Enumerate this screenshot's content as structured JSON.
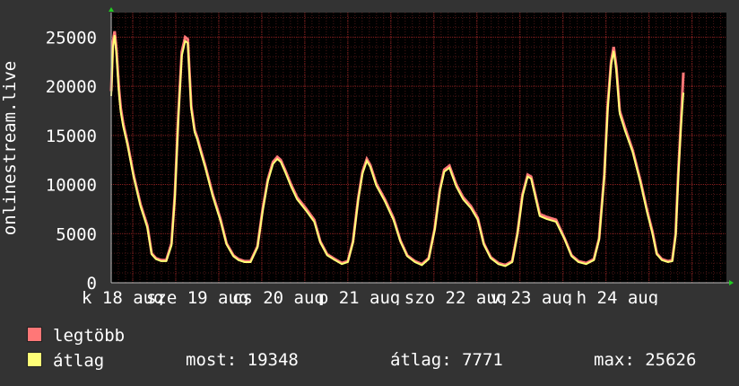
{
  "chart_data": {
    "type": "line",
    "ylabel": "onlinestream.live",
    "ylim": [
      0,
      27500
    ],
    "yticks": [
      0,
      5000,
      10000,
      15000,
      20000,
      25000
    ],
    "xlim": [
      0,
      7.15
    ],
    "xticks": [
      {
        "x": 0.0,
        "label": "k 18 aug"
      },
      {
        "x": 0.75,
        "label": "sze 19 aug"
      },
      {
        "x": 1.75,
        "label": "cs 20 aug"
      },
      {
        "x": 2.75,
        "label": "p 21 aug"
      },
      {
        "x": 3.75,
        "label": "szo 22 aug"
      },
      {
        "x": 4.75,
        "label": "v 23 aug"
      },
      {
        "x": 5.75,
        "label": "h 24 aug"
      }
    ],
    "grid": true,
    "colors": {
      "max": "#ff7777",
      "avg": "#ffff77",
      "grid": "#8a2020",
      "axis": "#bbbbbb"
    },
    "series": [
      {
        "name": "legtöbb",
        "x": [
          0.0,
          0.02,
          0.04,
          0.06,
          0.09,
          0.11,
          0.14,
          0.19,
          0.26,
          0.34,
          0.42,
          0.47,
          0.52,
          0.58,
          0.64,
          0.7,
          0.74,
          0.78,
          0.82,
          0.86,
          0.89,
          0.93,
          0.97,
          1.0,
          1.04,
          1.09,
          1.18,
          1.27,
          1.34,
          1.42,
          1.48,
          1.55,
          1.62,
          1.7,
          1.76,
          1.82,
          1.88,
          1.93,
          1.97,
          2.02,
          2.09,
          2.16,
          2.26,
          2.36,
          2.43,
          2.51,
          2.6,
          2.68,
          2.75,
          2.81,
          2.87,
          2.92,
          2.97,
          3.01,
          3.08,
          3.18,
          3.28,
          3.36,
          3.44,
          3.53,
          3.61,
          3.69,
          3.76,
          3.82,
          3.87,
          3.93,
          3.96,
          4.01,
          4.09,
          4.18,
          4.26,
          4.33,
          4.41,
          4.5,
          4.58,
          4.66,
          4.72,
          4.78,
          4.84,
          4.88,
          4.92,
          4.98,
          5.06,
          5.17,
          5.27,
          5.35,
          5.43,
          5.52,
          5.61,
          5.67,
          5.73,
          5.77,
          5.81,
          5.84,
          5.87,
          5.91,
          5.97,
          6.06,
          6.15,
          6.23,
          6.29,
          6.34,
          6.4,
          6.47,
          6.52,
          6.56,
          6.59,
          6.62,
          6.65
        ],
        "values": [
          19500,
          24500,
          25600,
          23800,
          19800,
          17800,
          16200,
          14200,
          11000,
          8000,
          5800,
          3000,
          2500,
          2300,
          2300,
          4000,
          9000,
          17000,
          23500,
          25000,
          24800,
          18000,
          15500,
          14800,
          13500,
          12000,
          9000,
          6500,
          4000,
          2800,
          2400,
          2200,
          2200,
          3700,
          7500,
          10500,
          12300,
          12800,
          12500,
          11500,
          10000,
          8700,
          7600,
          6400,
          4200,
          2900,
          2400,
          2000,
          2200,
          4200,
          8600,
          11300,
          12600,
          12000,
          10100,
          8500,
          6600,
          4300,
          2800,
          2200,
          1900,
          2500,
          5500,
          9500,
          11500,
          11900,
          11200,
          10000,
          8700,
          7800,
          6600,
          4000,
          2600,
          2000,
          1800,
          2200,
          5000,
          9000,
          11000,
          10800,
          9300,
          7000,
          6700,
          6400,
          4500,
          2800,
          2200,
          2000,
          2400,
          4500,
          11000,
          18000,
          22500,
          24000,
          22000,
          17500,
          15800,
          13500,
          10400,
          7300,
          5200,
          3000,
          2400,
          2200,
          2300,
          5000,
          11200,
          16000,
          21400
        ]
      },
      {
        "name": "átlag",
        "x": [
          0.0,
          0.02,
          0.04,
          0.06,
          0.09,
          0.11,
          0.14,
          0.19,
          0.26,
          0.34,
          0.42,
          0.47,
          0.52,
          0.58,
          0.64,
          0.7,
          0.74,
          0.78,
          0.82,
          0.86,
          0.89,
          0.93,
          0.97,
          1.0,
          1.04,
          1.09,
          1.18,
          1.27,
          1.34,
          1.42,
          1.48,
          1.55,
          1.62,
          1.7,
          1.76,
          1.82,
          1.88,
          1.93,
          1.97,
          2.02,
          2.09,
          2.16,
          2.26,
          2.36,
          2.43,
          2.51,
          2.6,
          2.68,
          2.75,
          2.81,
          2.87,
          2.92,
          2.97,
          3.01,
          3.08,
          3.18,
          3.28,
          3.36,
          3.44,
          3.53,
          3.61,
          3.69,
          3.76,
          3.82,
          3.87,
          3.93,
          3.96,
          4.01,
          4.09,
          4.18,
          4.26,
          4.33,
          4.41,
          4.5,
          4.58,
          4.66,
          4.72,
          4.78,
          4.84,
          4.88,
          4.92,
          4.98,
          5.06,
          5.17,
          5.27,
          5.35,
          5.43,
          5.52,
          5.61,
          5.67,
          5.73,
          5.77,
          5.81,
          5.84,
          5.87,
          5.91,
          5.97,
          6.06,
          6.15,
          6.23,
          6.29,
          6.34,
          6.4,
          6.47,
          6.52,
          6.56,
          6.59,
          6.62,
          6.65
        ],
        "values": [
          19000,
          24000,
          25200,
          23300,
          19300,
          17400,
          15900,
          14000,
          10800,
          7800,
          5600,
          2900,
          2400,
          2200,
          2200,
          3800,
          8700,
          16600,
          23100,
          24600,
          24400,
          17700,
          15300,
          14600,
          13300,
          11800,
          8800,
          6300,
          3900,
          2700,
          2300,
          2100,
          2100,
          3600,
          7300,
          10300,
          12100,
          12600,
          12300,
          11300,
          9800,
          8500,
          7400,
          6200,
          4100,
          2800,
          2300,
          1900,
          2100,
          4100,
          8400,
          11100,
          12400,
          11800,
          9900,
          8300,
          6400,
          4200,
          2700,
          2100,
          1800,
          2400,
          5400,
          9300,
          11300,
          11700,
          11000,
          9800,
          8500,
          7600,
          6400,
          3900,
          2500,
          1900,
          1700,
          2100,
          4900,
          8800,
          10800,
          10600,
          9100,
          6800,
          6500,
          6200,
          4400,
          2700,
          2100,
          1900,
          2300,
          4400,
          10700,
          17700,
          22200,
          23600,
          21600,
          17200,
          15500,
          13300,
          10200,
          7100,
          5000,
          2900,
          2300,
          2100,
          2200,
          4800,
          10800,
          15600,
          19348
        ]
      }
    ]
  },
  "legend": {
    "max_label": "legtöbb",
    "avg_label": "átlag"
  },
  "stats": {
    "current": "most: 19348",
    "average": "átlag: 7771",
    "maximum": "max: 25626"
  }
}
